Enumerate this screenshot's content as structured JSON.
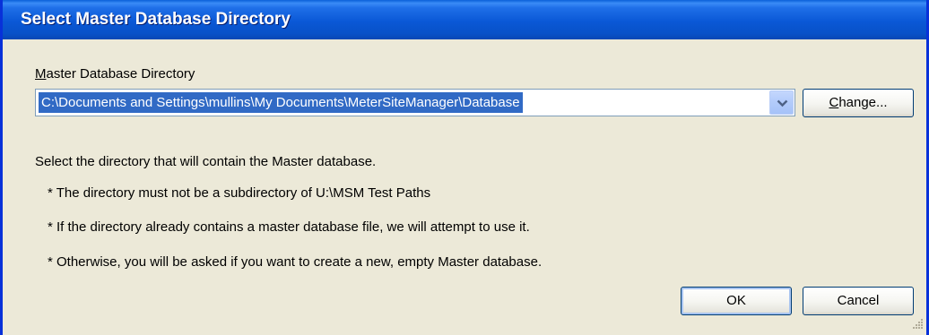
{
  "window": {
    "title": "Select Master Database Directory"
  },
  "directory": {
    "label_accel": "M",
    "label_rest": "aster Database Directory",
    "value": "C:\\Documents and Settings\\mullins\\My Documents\\MeterSiteManager\\Database"
  },
  "buttons": {
    "change_accel": "C",
    "change_rest": "hange...",
    "ok": "OK",
    "cancel": "Cancel"
  },
  "instructions": {
    "intro": "Select the directory that will contain the Master database.",
    "bullets": [
      "* The directory must not be a subdirectory of U:\\MSM Test Paths",
      "* If the directory already contains a master database file, we will attempt to use it.",
      "* Otherwise, you will be asked if you want to create a new, empty Master database."
    ]
  },
  "icons": {
    "dropdown": "chevron-down-icon",
    "resize": "resize-grip-icon"
  },
  "colors": {
    "titlebar": "#0a58d6",
    "dialog_bg": "#ece9d8",
    "selection": "#316ac5"
  }
}
